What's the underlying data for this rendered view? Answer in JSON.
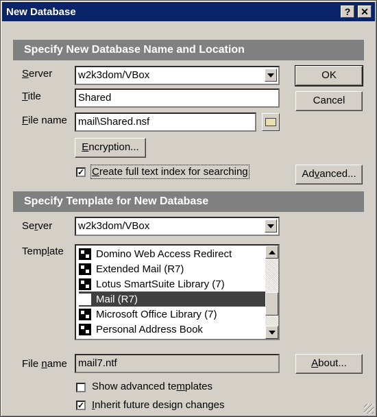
{
  "window": {
    "title": "New Database",
    "help_btn": "?",
    "close_btn": "✕"
  },
  "section1": {
    "header": "Specify New Database Name and Location",
    "server_label": "Server",
    "server_value": "w2k3dom/VBox",
    "title_label": "Title",
    "title_value": "Shared",
    "filename_label": "File name",
    "filename_value": "mail\\Shared.nsf",
    "encryption_btn": "Encryption...",
    "fulltext_label": "Create full text index for searching",
    "fulltext_checked": "✓"
  },
  "buttons": {
    "ok": "OK",
    "cancel": "Cancel",
    "advanced": "Advanced...",
    "about": "About..."
  },
  "section2": {
    "header": "Specify Template for New Database",
    "server_label": "Server",
    "server_value": "w2k3dom/VBox",
    "template_label": "Template",
    "templates": [
      "Domino Web Access Redirect",
      "Extended Mail (R7)",
      "Lotus SmartSuite Library (7)",
      "Mail (R7)",
      "Microsoft Office Library (7)",
      "Personal Address Book"
    ],
    "selected_template": "Mail (R7)",
    "filename_label": "File name",
    "filename_value": "mail7.ntf",
    "show_advanced_label": "Show advanced templates",
    "inherit_label": "Inherit future design changes",
    "inherit_checked": "✓"
  }
}
